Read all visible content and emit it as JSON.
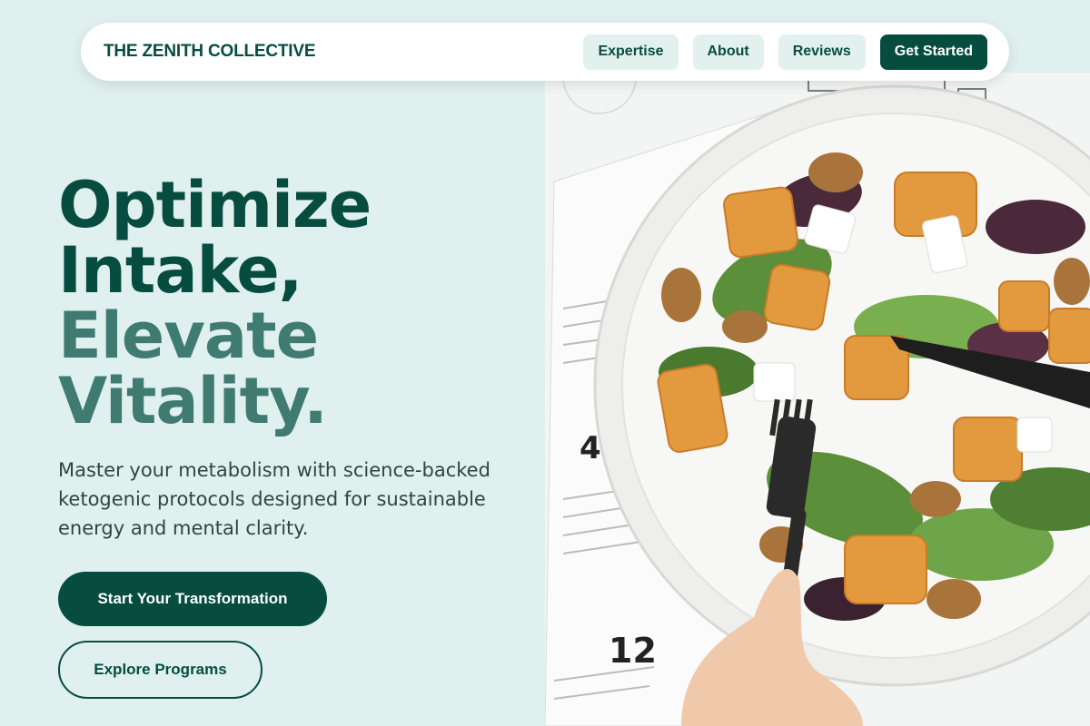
{
  "nav": {
    "brand": "THE ZENITH COLLECTIVE",
    "links": [
      "Expertise",
      "About",
      "Reviews"
    ],
    "cta_label": "Get Started"
  },
  "hero": {
    "headline_lines": [
      "Optimize",
      "Intake,",
      "Elevate",
      "Vitality."
    ],
    "subtext": "Master your metabolism with science-backed ketogenic protocols designed for sustainable energy and mental clarity.",
    "primary_button": "Start Your Transformation",
    "secondary_button": "Explore Programs",
    "image_alt": "Plate of salad with roasted squash, feta, walnuts and greens"
  },
  "colors": {
    "background": "#dff0ee",
    "primary": "#064d40",
    "accent_light": "#3f7b71",
    "nav_pill": "#e2f1ee"
  }
}
